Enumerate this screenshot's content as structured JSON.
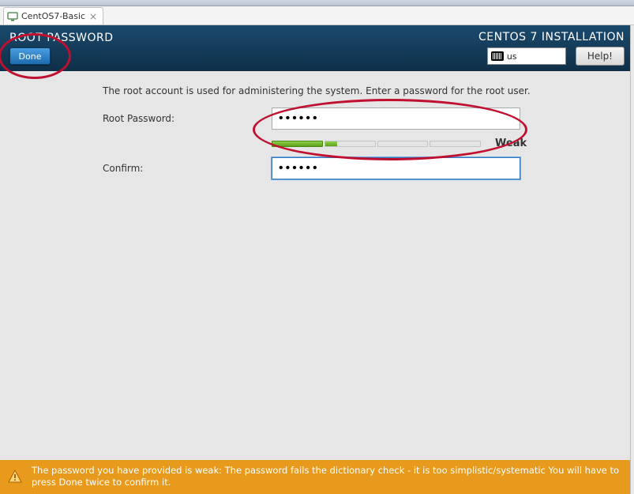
{
  "tab": {
    "title": "CentOS7-Basic"
  },
  "header": {
    "page_title": "ROOT PASSWORD",
    "done_label": "Done",
    "install_title": "CENTOS 7 INSTALLATION",
    "keyboard_layout": "us",
    "help_label": "Help!"
  },
  "content": {
    "description": "The root account is used for administering the system.  Enter a password for the root user.",
    "password_label": "Root Password:",
    "password_value": "••••••",
    "confirm_label": "Confirm:",
    "confirm_value": "••••••",
    "strength_label": "Weak"
  },
  "warning": {
    "text": "The password you have provided is weak: The password fails the dictionary check - it is too simplistic/systematic You will have to press Done twice to confirm it."
  }
}
